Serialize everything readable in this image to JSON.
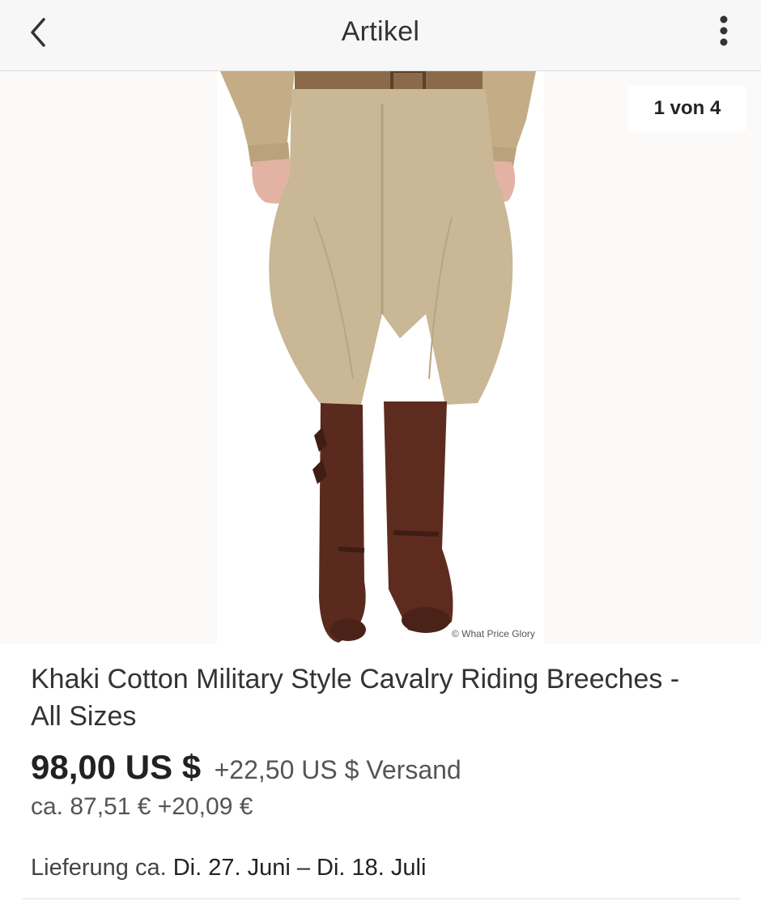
{
  "navbar": {
    "title": "Artikel",
    "back_icon": "chevron-left-icon",
    "more_icon": "vertical-dots-icon"
  },
  "gallery": {
    "counter": "1 von 4",
    "watermark": "© What Price Glory"
  },
  "item": {
    "title": "Khaki Cotton Military Style Cavalry Riding Breeches - All Sizes",
    "price": "98,00 US $",
    "shipping": "+22,50 US $ Versand",
    "converted": "ca. 87,51 € +20,09 €",
    "delivery_label": "Lieferung ca.",
    "delivery_dates": "Di. 27. Juni – Di. 18. Juli"
  },
  "colors": {
    "khaki": "#c9b795",
    "boot_brown": "#5a2a1e",
    "skin": "#e2b3a3"
  }
}
